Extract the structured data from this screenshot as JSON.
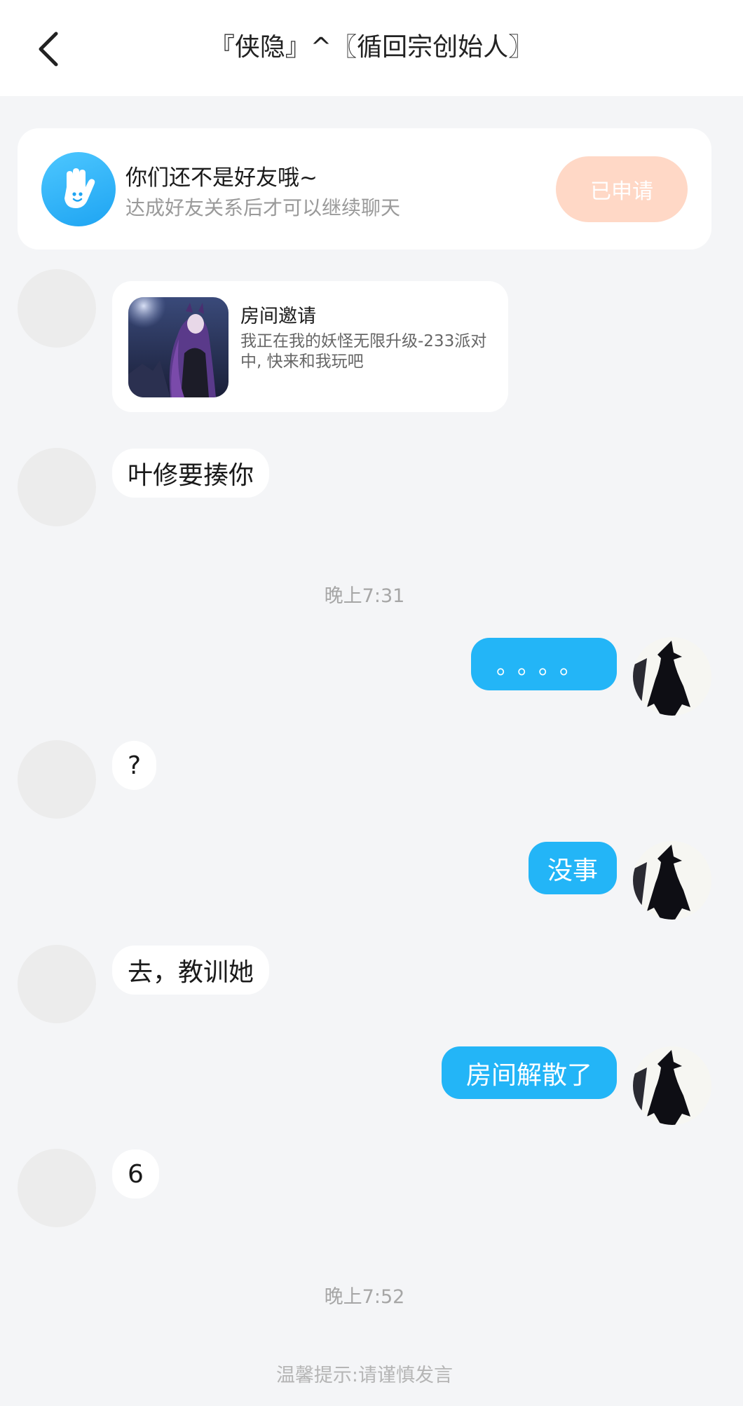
{
  "header": {
    "title": "『侠隐』^〖循回宗创始人〗"
  },
  "friend_notice": {
    "title": "你们还不是好友哦~",
    "subtitle": "达成好友关系后才可以继续聊天",
    "button_label": "已申请",
    "icon": "wave-hand-icon"
  },
  "invite": {
    "title": "房间邀请",
    "description": "我正在我的妖怪无限升级-233派对中, 快来和我玩吧"
  },
  "messages": [
    {
      "side": "left",
      "text": "叶修要揍你"
    },
    {
      "side": "time",
      "text": "晚上7:31"
    },
    {
      "side": "right",
      "text": "。。。。"
    },
    {
      "side": "left",
      "text": "?"
    },
    {
      "side": "right",
      "text": "没事"
    },
    {
      "side": "left",
      "text": "去，教训她"
    },
    {
      "side": "right",
      "text": "房间解散了"
    },
    {
      "side": "left",
      "text": "6"
    },
    {
      "side": "time",
      "text": "晚上7:52"
    }
  ],
  "footer_tip": "温馨提示:请谨慎发言",
  "colors": {
    "accent": "#23b5f7",
    "applied_button": "#ffd8c6",
    "background": "#f4f5f7"
  }
}
